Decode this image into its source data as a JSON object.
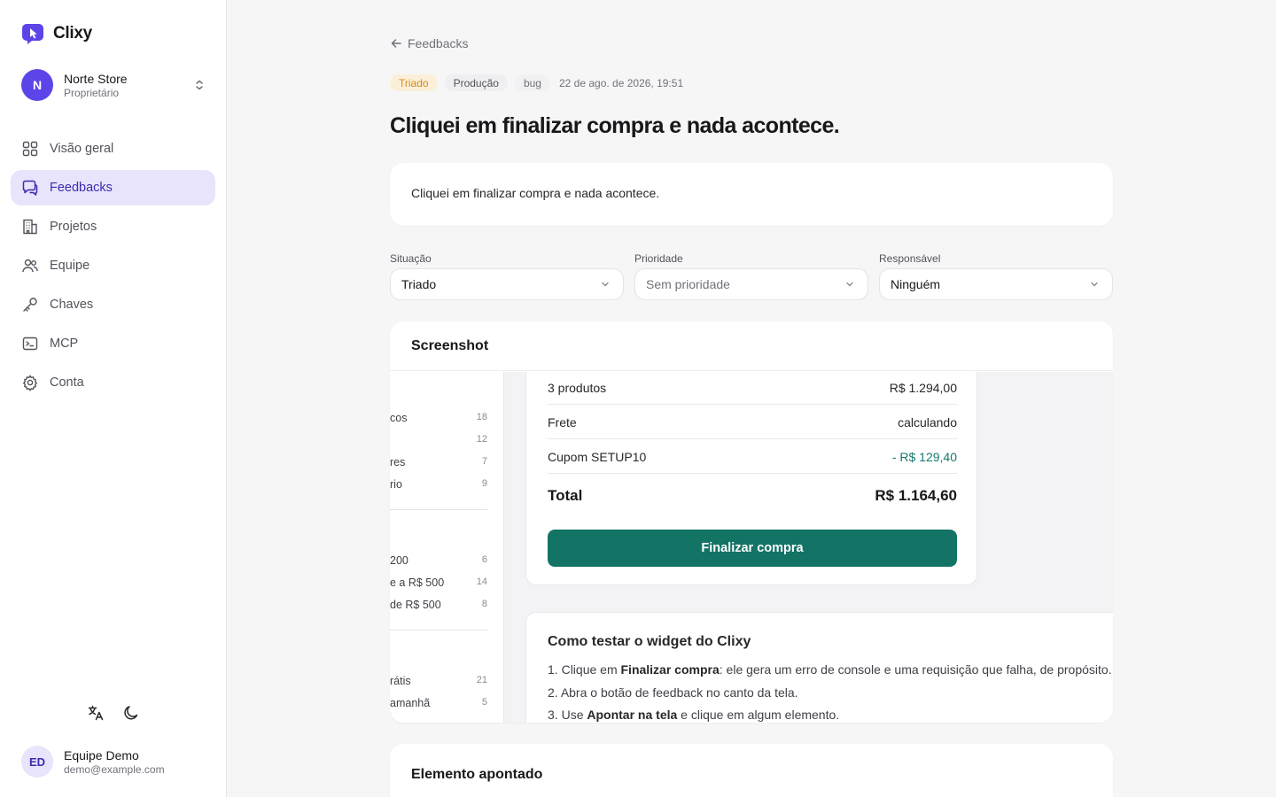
{
  "brand": {
    "name": "Clixy",
    "accent": "#5b45e8"
  },
  "workspace": {
    "initial": "N",
    "name": "Norte Store",
    "role": "Proprietário"
  },
  "nav": [
    {
      "label": "Visão geral",
      "icon": "grid-icon",
      "active": false
    },
    {
      "label": "Feedbacks",
      "icon": "message-icon",
      "active": true
    },
    {
      "label": "Projetos",
      "icon": "building-icon",
      "active": false
    },
    {
      "label": "Equipe",
      "icon": "users-icon",
      "active": false
    },
    {
      "label": "Chaves",
      "icon": "key-icon",
      "active": false
    },
    {
      "label": "MCP",
      "icon": "terminal-icon",
      "active": false
    },
    {
      "label": "Conta",
      "icon": "gear-icon",
      "active": false
    }
  ],
  "user": {
    "initials": "ED",
    "name": "Equipe Demo",
    "email": "demo@example.com"
  },
  "back": {
    "label": "Feedbacks"
  },
  "badges": {
    "status": "Triado",
    "environment": "Produção",
    "type": "bug",
    "date": "22 de ago. de 2026, 19:51"
  },
  "title": "Cliquei em finalizar compra e nada acontece.",
  "description": "Cliquei em finalizar compra e nada acontece.",
  "fields": {
    "situacao": {
      "label": "Situação",
      "value": "Triado"
    },
    "prioridade": {
      "label": "Prioridade",
      "value": "Sem prioridade"
    },
    "responsavel": {
      "label": "Responsável",
      "value": "Ninguém"
    }
  },
  "screenshot": {
    "title": "Screenshot",
    "filters": [
      {
        "label": "cos",
        "count": "18"
      },
      {
        "label": "",
        "count": "12"
      },
      {
        "label": "res",
        "count": "7"
      },
      {
        "label": "rio",
        "count": "9"
      },
      {
        "label": "200",
        "count": "6"
      },
      {
        "label": "e a R$ 500",
        "count": "14"
      },
      {
        "label": "de R$ 500",
        "count": "8"
      },
      {
        "label": "rátis",
        "count": "21"
      },
      {
        "label": "amanhã",
        "count": "5"
      }
    ],
    "summary": {
      "products_label": "3 produtos",
      "products_value": "R$ 1.294,00",
      "shipping_label": "Frete",
      "shipping_value": "calculando",
      "coupon_label": "Cupom SETUP10",
      "coupon_value": "- R$ 129,40",
      "total_label": "Total",
      "total_value": "R$ 1.164,60",
      "button": "Finalizar compra"
    },
    "howto": {
      "title": "Como testar o widget do Clixy",
      "steps": [
        {
          "n": "1.",
          "pre": "Clique em ",
          "bold": "Finalizar compra",
          "post": ": ele gera um erro de console e uma requisição que falha, de propósito."
        },
        {
          "n": "2.",
          "pre": "Abra o botão de feedback no canto da tela.",
          "bold": "",
          "post": ""
        },
        {
          "n": "3.",
          "pre": "Use ",
          "bold": "Apontar na tela",
          "post": " e clique em algum elemento."
        }
      ]
    }
  },
  "element_card": {
    "title": "Elemento apontado"
  }
}
